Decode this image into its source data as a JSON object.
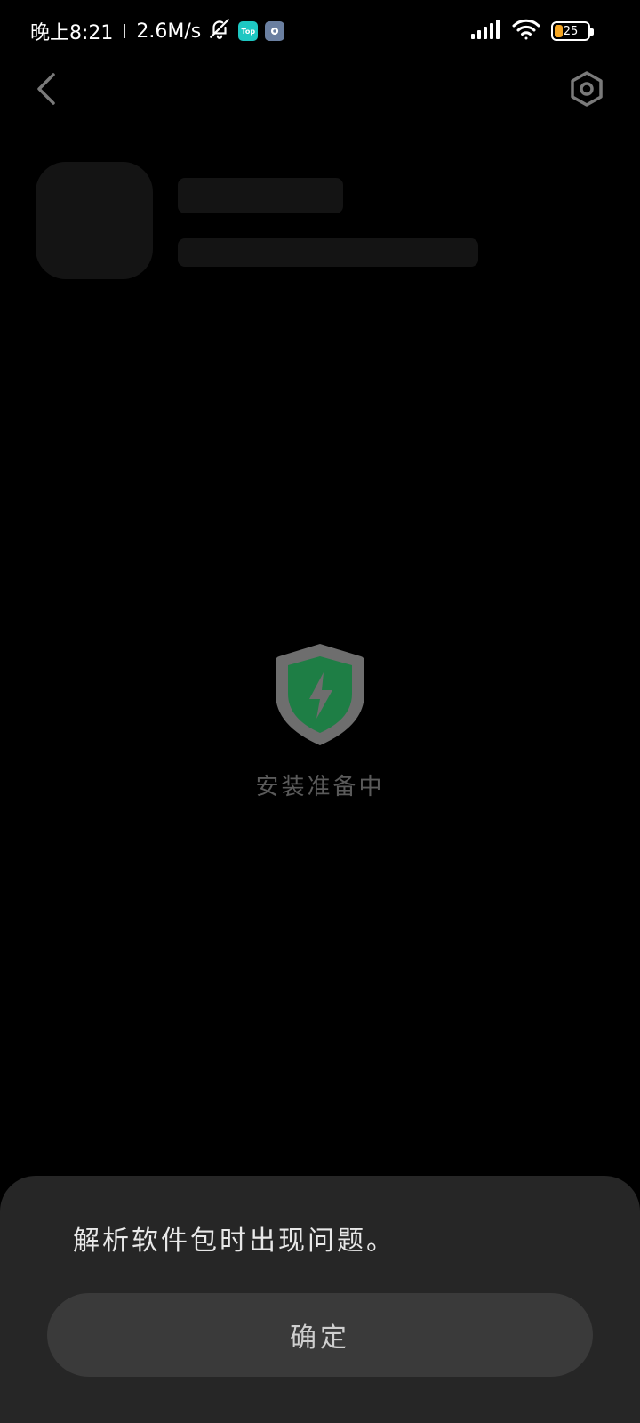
{
  "status_bar": {
    "time": "晚上8:21",
    "speed": "2.6M/s",
    "top_app_label": "Top",
    "battery_level": "25",
    "battery_fraction": 0.25,
    "battery_color": "#F5A623"
  },
  "icons": {
    "mute": "bell-off-icon",
    "top_app": "top-app-icon",
    "gear_app": "gear-app-icon",
    "signal": "signal-icon",
    "wifi": "wifi-icon",
    "battery": "battery-icon",
    "back": "chevron-left-icon",
    "settings": "hexagon-settings-icon",
    "shield": "shield-bolt-icon"
  },
  "loading": {
    "text": "安装准备中",
    "shield_color": "#1E7E45"
  },
  "dialog": {
    "message": "解析软件包时出现问题。",
    "confirm_label": "确定"
  }
}
